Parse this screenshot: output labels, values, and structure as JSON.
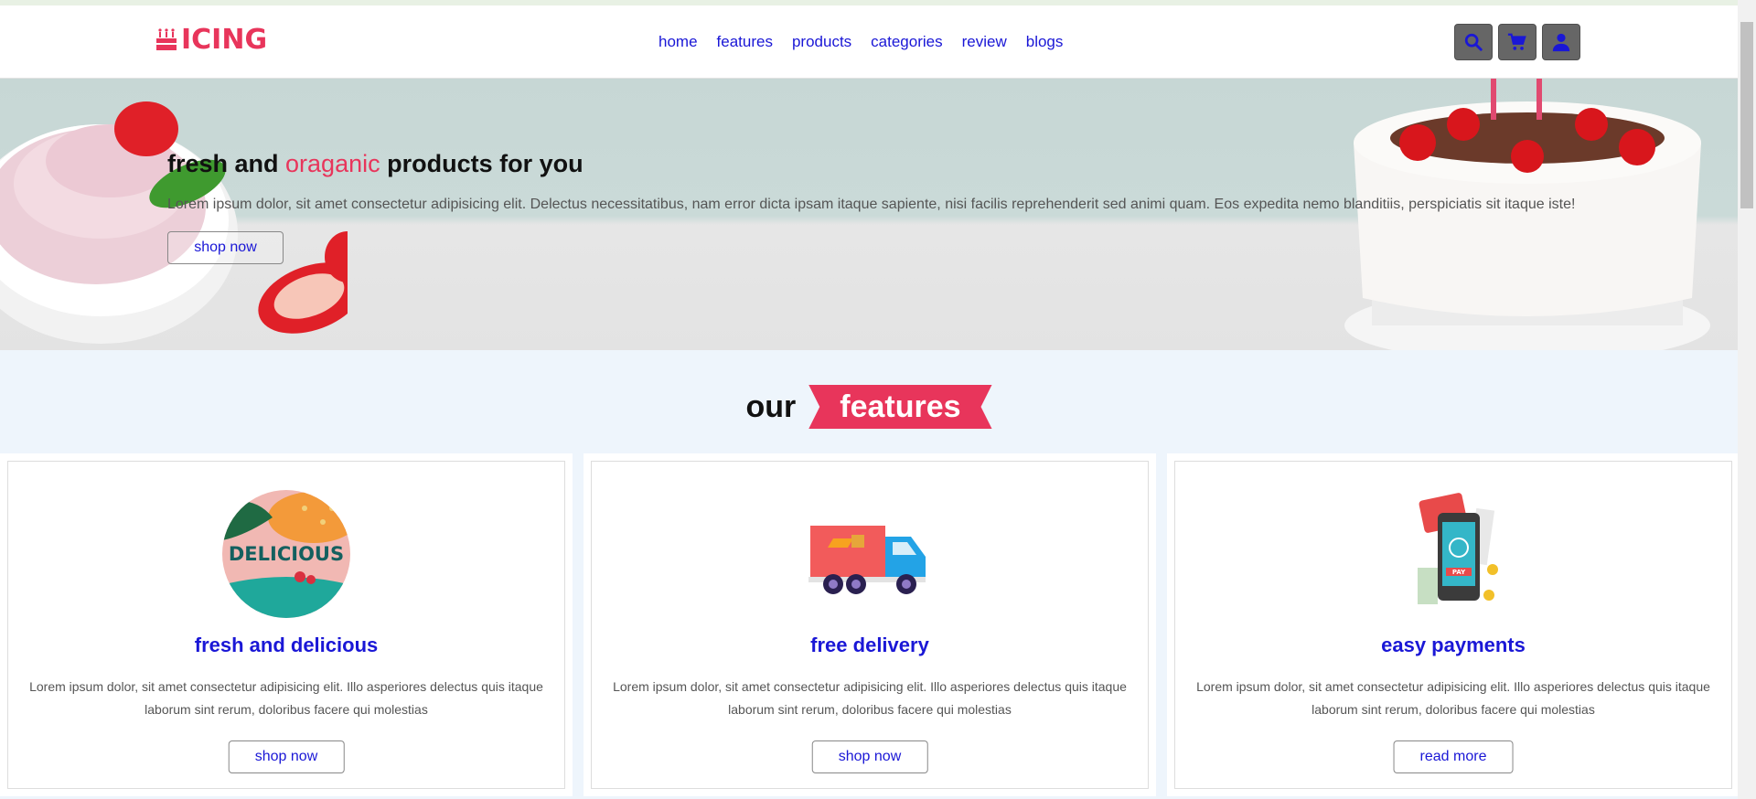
{
  "header": {
    "logo_text": "ICING",
    "nav": [
      "home",
      "features",
      "products",
      "categories",
      "review",
      "blogs"
    ],
    "icons": [
      "search-icon",
      "cart-icon",
      "user-icon"
    ]
  },
  "hero": {
    "title_part1": "fresh and ",
    "title_accent": "oraganic",
    "title_part2": " products for you",
    "text": "Lorem ipsum dolor, sit amet consectetur adipisicing elit. Delectus necessitatibus, nam error dicta ipsam itaque sapiente, nisi facilis reprehenderit sed animi quam. Eos expedita nemo blanditiis, perspiciatis sit itaque iste!",
    "button": "shop now"
  },
  "features": {
    "heading_plain": "our",
    "heading_ribbon": "features",
    "cards": [
      {
        "image_text": "DELICIOUS",
        "title": "fresh and delicious",
        "text": "Lorem ipsum dolor, sit amet consectetur adipisicing elit. Illo asperiores delectus quis itaque laborum sint rerum, doloribus facere qui molestias",
        "button": "shop now"
      },
      {
        "title": "free delivery",
        "text": "Lorem ipsum dolor, sit amet consectetur adipisicing elit. Illo asperiores delectus quis itaque laborum sint rerum, doloribus facere qui molestias",
        "button": "shop now"
      },
      {
        "image_text": "PAY",
        "title": "easy payments",
        "text": "Lorem ipsum dolor, sit amet consectetur adipisicing elit. Illo asperiores delectus quis itaque laborum sint rerum, doloribus facere qui molestias",
        "button": "read more"
      }
    ]
  },
  "colors": {
    "accent": "#e8355b",
    "link": "#1a17d6",
    "icon_button_bg": "#666666"
  }
}
